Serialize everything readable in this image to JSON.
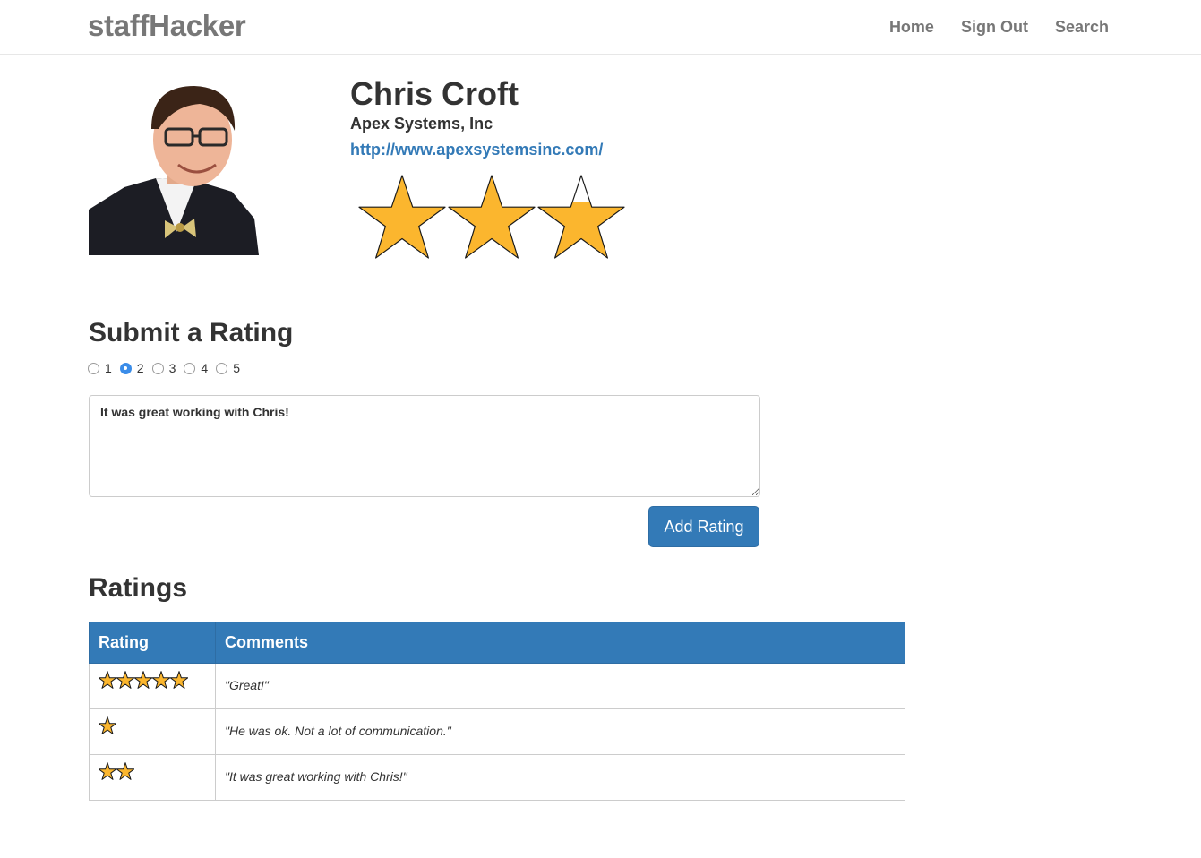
{
  "navbar": {
    "brand": "staffHacker",
    "links": [
      "Home",
      "Sign Out",
      "Search"
    ]
  },
  "profile": {
    "name": "Chris Croft",
    "company": "Apex Systems, Inc",
    "url": "http://www.apexsystemsinc.com/",
    "average_rating": 2.67,
    "max_rating": 3,
    "star_color": "#fbb62e"
  },
  "submit_form": {
    "heading": "Submit a Rating",
    "options": [
      "1",
      "2",
      "3",
      "4",
      "5"
    ],
    "selected": "2",
    "comment_value": "It was great working with Chris!",
    "button_label": "Add Rating"
  },
  "ratings": {
    "heading": "Ratings",
    "columns": [
      "Rating",
      "Comments"
    ],
    "rows": [
      {
        "stars": 5,
        "comment": "\"Great!\""
      },
      {
        "stars": 1,
        "comment": "\"He was ok. Not a lot of communication.\""
      },
      {
        "stars": 2,
        "comment": "\"It was great working with Chris!\""
      }
    ]
  },
  "colors": {
    "accent": "#337ab7",
    "nav_text": "#777777",
    "star_fill": "#fbb62e"
  }
}
